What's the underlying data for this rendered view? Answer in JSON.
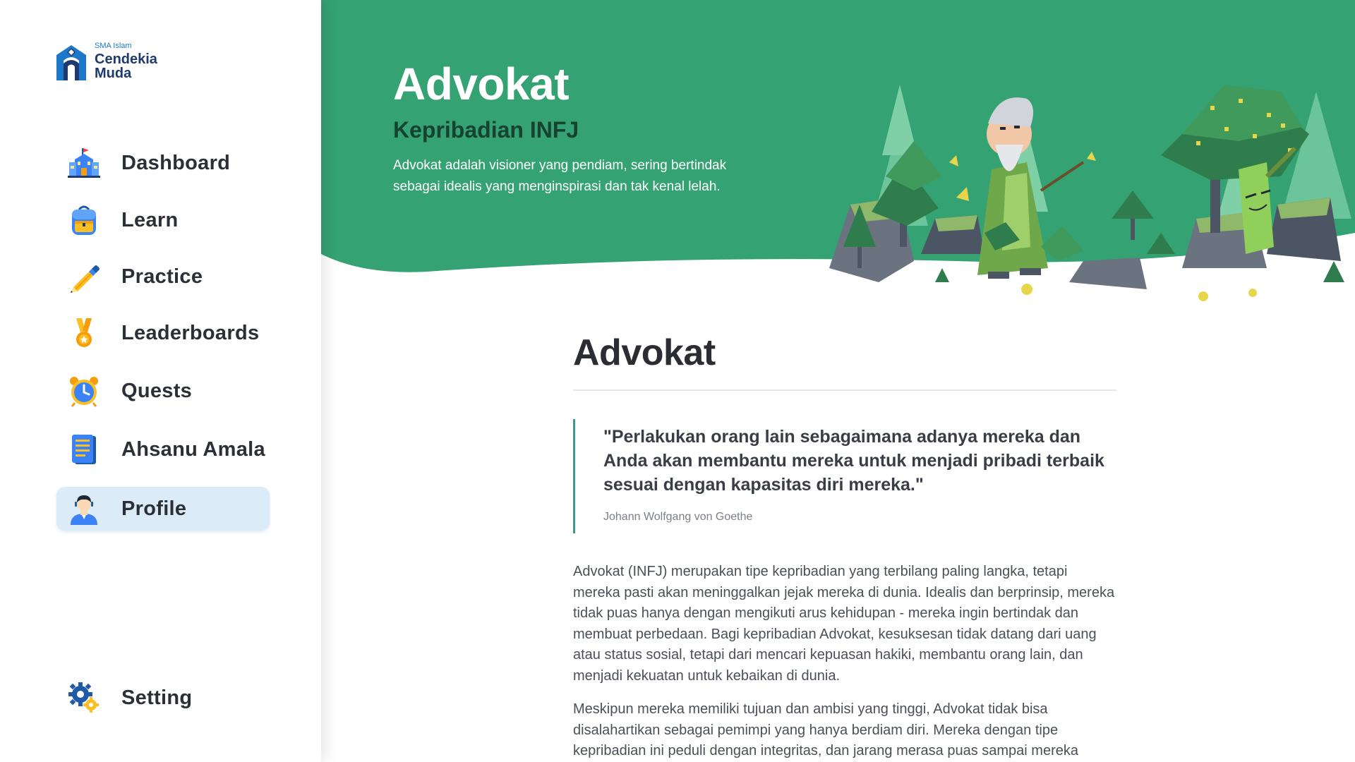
{
  "sidebar": {
    "logo": {
      "sub": "SMA Islam",
      "name_line1": "Cendekia",
      "name_line2": "Muda"
    },
    "items": [
      {
        "label": "Dashboard",
        "icon": "school-building-icon"
      },
      {
        "label": "Learn",
        "icon": "backpack-icon"
      },
      {
        "label": "Practice",
        "icon": "pencil-icon"
      },
      {
        "label": "Leaderboards",
        "icon": "medal-icon"
      },
      {
        "label": "Quests",
        "icon": "alarm-clock-icon"
      },
      {
        "label": "Ahsanu Amala",
        "icon": "notebook-icon"
      },
      {
        "label": "Profile",
        "icon": "user-avatar-icon",
        "active": true
      }
    ],
    "setting": {
      "label": "Setting",
      "icon": "gear-icon"
    }
  },
  "hero": {
    "title": "Advokat",
    "subtitle": "Kepribadian INFJ",
    "description": "Advokat adalah visioner yang pendiam, sering bertindak sebagai idealis yang menginspirasi dan tak kenal lelah."
  },
  "article": {
    "title": "Advokat",
    "quote": "\"Perlakukan orang lain sebagaimana adanya mereka dan Anda akan membantu mereka untuk menjadi pribadi terbaik sesuai dengan kapasitas diri mereka.\"",
    "quote_author": "Johann Wolfgang von Goethe",
    "paragraphs": [
      "Advokat (INFJ) merupakan tipe kepribadian yang terbilang paling langka, tetapi mereka pasti akan meninggalkan jejak mereka di dunia. Idealis dan berprinsip, mereka tidak puas hanya dengan mengikuti arus kehidupan - mereka ingin bertindak dan membuat perbedaan. Bagi kepribadian Advokat, kesuksesan tidak datang dari uang atau status sosial, tetapi dari mencari kepuasan hakiki, membantu orang lain, dan menjadi kekuatan untuk kebaikan di dunia.",
      "Meskipun mereka memiliki tujuan dan ambisi yang tinggi, Advokat tidak bisa disalahartikan sebagai pemimpi yang hanya berdiam diri. Mereka dengan tipe kepribadian ini peduli dengan integritas, dan jarang merasa puas sampai mereka"
    ]
  },
  "colors": {
    "hero_green": "#34a272",
    "subtitle_dark": "#16422e",
    "active_bg": "#dcebf8",
    "quote_border": "#3d9a8a"
  }
}
